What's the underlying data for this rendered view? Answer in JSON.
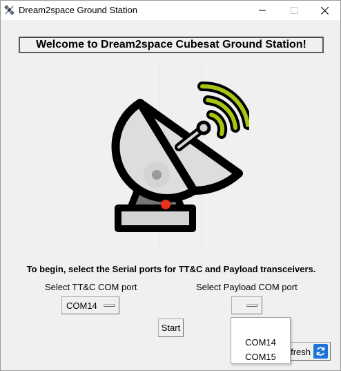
{
  "window": {
    "title": "Dream2space Ground Station"
  },
  "titlebar_icons": {
    "app": "satellite-app-icon",
    "minimize": "minimize-icon",
    "maximize": "maximize-icon",
    "close": "close-icon"
  },
  "welcome_banner": "Welcome to Dream2space Cubesat Ground Station!",
  "logo": {
    "icon": "satellite-dish-icon",
    "colors": {
      "outline": "#000000",
      "dish": "#dddddd",
      "base": "#757575",
      "signal": "#a6c411",
      "indicator": "#e8321a"
    }
  },
  "instruction": "To begin, select the Serial ports for TT&C and Payload transceivers.",
  "ttc_port": {
    "label": "Select TT&C COM port",
    "selected": "COM14"
  },
  "payload_port": {
    "label": "Select Payload COM port",
    "selected": "",
    "options": [
      "COM14",
      "COM15"
    ]
  },
  "buttons": {
    "start": "Start",
    "refresh": "fresh",
    "refresh_icon": "refresh-icon",
    "refresh_icon_color": "#1e74d6"
  }
}
